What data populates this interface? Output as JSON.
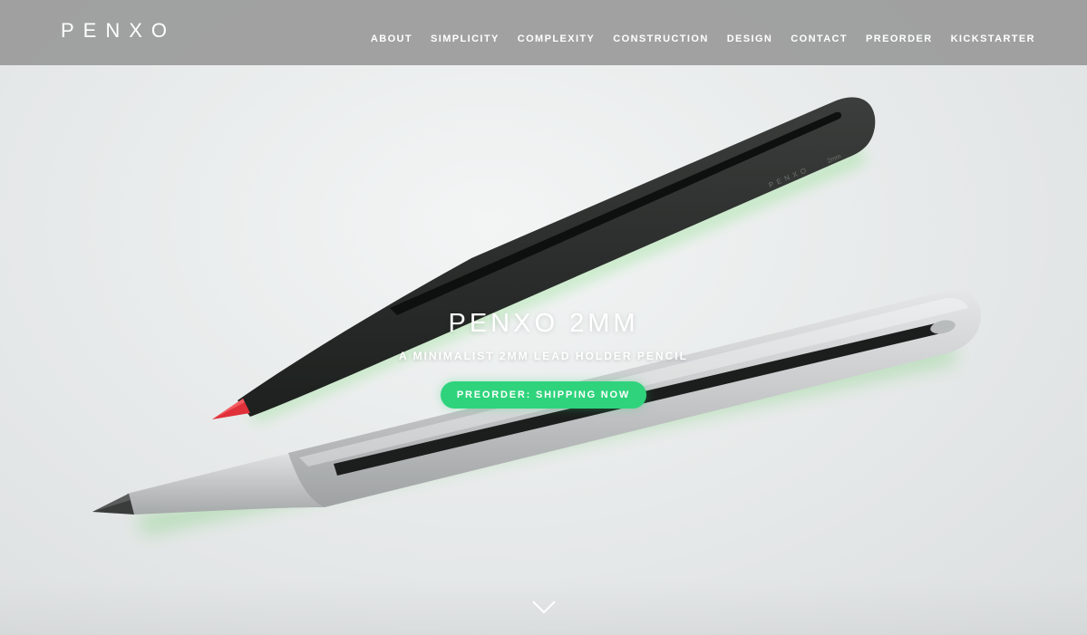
{
  "site": {
    "logo": "PENXO"
  },
  "nav": {
    "items": [
      {
        "label": "ABOUT"
      },
      {
        "label": "SIMPLICITY"
      },
      {
        "label": "COMPLEXITY"
      },
      {
        "label": "CONSTRUCTION"
      },
      {
        "label": "DESIGN"
      },
      {
        "label": "CONTACT"
      },
      {
        "label": "PREORDER"
      },
      {
        "label": "KICKSTARTER"
      }
    ]
  },
  "hero": {
    "title": "PENXO 2MM",
    "subtitle": "A MINIMALIST 2MM LEAD HOLDER PENCIL",
    "cta_label": "PREORDER: SHIPPING NOW",
    "scroll_icon": "chevron-down-icon",
    "image_subject": "black-pencil-and-silver-pencil"
  },
  "colors": {
    "nav_background": "#969696",
    "cta_background": "#2fd37c",
    "text": "#ffffff",
    "black_pencil_lead_tip": "#e0303a"
  }
}
